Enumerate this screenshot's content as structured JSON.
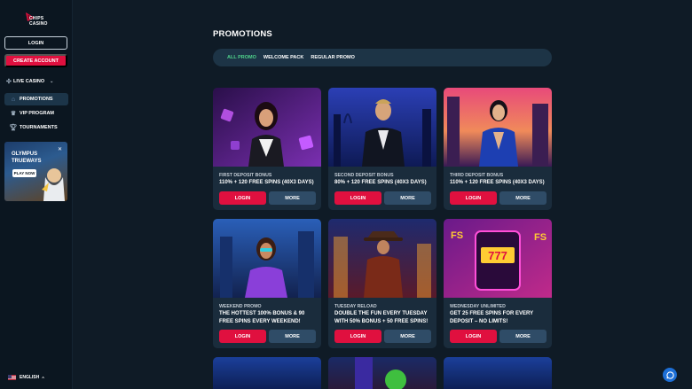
{
  "sidebar": {
    "logo_text": "CHIPS\nCASINO",
    "login_label": "LOGIN",
    "create_account_label": "CREATE ACCOUNT",
    "live_casino_label": "LIVE CASINO",
    "nav_items": [
      {
        "label": "PROMOTIONS",
        "icon": "home-icon",
        "active": true
      },
      {
        "label": "VIP PROGRAM",
        "icon": "crown-icon",
        "active": false
      },
      {
        "label": "TOURNAMENTS",
        "icon": "trophy-icon",
        "active": false
      }
    ],
    "banner": {
      "title": "OLYMPUS\nTRUEWAYS",
      "button": "PLAY NOW"
    },
    "language": "ENGLISH"
  },
  "main": {
    "title": "PROMOTIONS",
    "tabs": [
      {
        "label": "ALL PROMO",
        "active": true
      },
      {
        "label": "WELCOME PACK",
        "active": false
      },
      {
        "label": "REGULAR PROMO",
        "active": false
      }
    ],
    "cards": [
      {
        "subtitle": "FIRST DEPOSIT BONUS",
        "description": "110% + 120 FREE SPINS (40X3 DAYS)",
        "login": "LOGIN",
        "more": "MORE"
      },
      {
        "subtitle": "SECOND DEPOSIT BONUS",
        "description": "80% + 120 FREE SPINS (40X3 DAYS)",
        "login": "LOGIN",
        "more": "MORE"
      },
      {
        "subtitle": "THIRD DEPOSIT BONUS",
        "description": "110% + 120 FREE SPINS (40X3 DAYS)",
        "login": "LOGIN",
        "more": "MORE"
      },
      {
        "subtitle": "WEEKEND PROMO",
        "description": "THE HOTTEST 100% BONUS & 90 FREE SPINS EVERY WEEKEND!",
        "login": "LOGIN",
        "more": "MORE"
      },
      {
        "subtitle": "TUESDAY RELOAD",
        "description": "DOUBLE THE FUN EVERY TUESDAY WITH 50% BONUS + 50 FREE SPINS!",
        "login": "LOGIN",
        "more": "MORE"
      },
      {
        "subtitle": "WEDNESDAY UNLIMITED",
        "description": "GET 25 FREE SPINS FOR EVERY DEPOSIT – NO LIMITS!",
        "login": "LOGIN",
        "more": "MORE"
      }
    ]
  },
  "colors": {
    "accent": "#e0103f",
    "secondary_button": "#2f4c67",
    "active_tab": "#4fd38b",
    "background": "#0f1b26"
  }
}
